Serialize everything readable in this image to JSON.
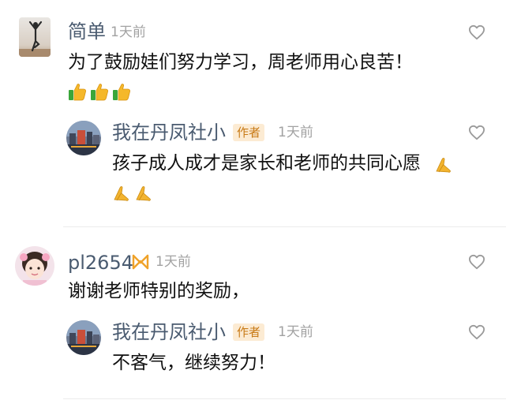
{
  "comments": [
    {
      "name": "简单",
      "time": "1天前",
      "text": "为了鼓励娃们努力学习，周老师用心良苦！",
      "reactions": [
        "thumbs-up-icon",
        "thumbs-up-icon",
        "thumbs-up-icon"
      ],
      "reply": {
        "name": "我在丹凤社小",
        "badge": "作者",
        "time": "1天前",
        "text": "孩子成人成才是家长和老师的共同心愿",
        "reactions": [
          "praying-hands-icon",
          "praying-hands-icon",
          "praying-hands-icon"
        ]
      }
    },
    {
      "name": "pl2654",
      "time": "1天前",
      "text": "谢谢老师特别的奖励，",
      "reply": {
        "name": "我在丹凤社小",
        "badge": "作者",
        "time": "1天前",
        "text": "不客气，继续努力！"
      }
    }
  ],
  "colors": {
    "name": "#4a5b70",
    "time": "#a2a2a2",
    "badge_text": "#c87a16",
    "badge_bg": "#fcebd3",
    "heart": "#9a9a9a"
  }
}
